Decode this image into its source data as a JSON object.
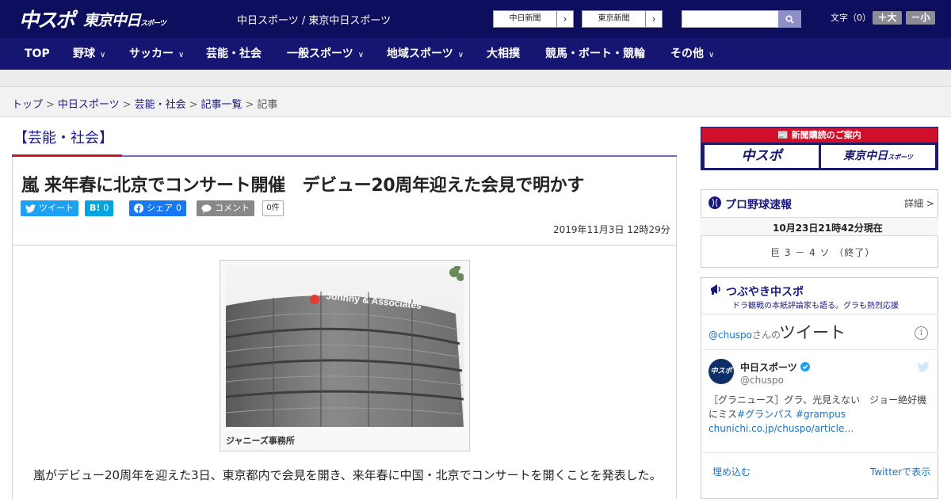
{
  "header": {
    "logo_chuspo": "中スポ",
    "logo_tokyo": "東京中日",
    "logo_tokyo_small": "スポーツ",
    "site_links": "中日スポーツ / 東京中日スポーツ",
    "paper_chunichi": "中日新聞",
    "paper_tokyo": "東京新聞",
    "search_placeholder": "",
    "font_size_label": "文字（0）",
    "font_larger": "＋大",
    "font_smaller": "－小"
  },
  "nav": {
    "items": [
      "TOP",
      "野球",
      "サッカー",
      "芸能・社会",
      "一般スポーツ",
      "地域スポーツ",
      "大相撲",
      "競馬・ボート・競輪",
      "その他"
    ]
  },
  "breadcrumb": {
    "top": "トップ",
    "chunichi_sports": "中日スポーツ",
    "section": "芸能・社会",
    "list": "記事一覧",
    "current": "記事",
    "sep": ">"
  },
  "article": {
    "section_label": "【芸能・社会】",
    "headline": "嵐 来年春に北京でコンサート開催　デビュー20周年迎えた会見で明かす",
    "share_tweet": "ツイート",
    "share_hatena": "B!",
    "share_hatena_count": "0",
    "share_facebook": "シェア",
    "share_facebook_count": "0",
    "share_comment": "コメント",
    "comment_count": "0件",
    "date": "2019年11月3日 12時29分",
    "photo_sign": "Johnny & Associates",
    "photo_caption": "ジャニーズ事務所",
    "body": "嵐がデビュー20周年を迎えた3日、東京都内で会見を開き、来年春に中国・北京でコンサートを開くことを発表した。"
  },
  "sidebar": {
    "subscription": {
      "title": "新聞購読のご案内",
      "chuspo": "中スポ",
      "tokyo": "東京中日",
      "tokyo_small": "スポーツ"
    },
    "baseball": {
      "title": "プロ野球速報",
      "detail": "詳細 >",
      "time": "10月23日21時42分現在",
      "score": "巨 3 － 4 ソ （終了）"
    },
    "tweets": {
      "title": "つぶやき中スポ",
      "subtitle": "ドラ観戦の本紙評論家も語る。グラも熱烈応援",
      "handle_prefix": "@chuspo",
      "handle_suffix": "さんの",
      "big_label": "ツイート",
      "avatar_text": "中スポ",
      "name": "中日スポーツ",
      "at": "@chuspo",
      "body_plain": "［グラニュース］グラ、光見えない　ジョー絶好機にミス",
      "body_tag1": "#グランパス",
      "body_tag2": "#grampus",
      "body_link": "chunichi.co.jp/chuspo/article…",
      "embed": "埋め込む",
      "view_on_twitter": "Twitterで表示"
    }
  },
  "colors": {
    "header_bg": "#0e0e5e",
    "nav_bg": "#161672",
    "accent_red": "#d0102b",
    "link_blue": "#1a1a7e",
    "twitter_blue": "#1da1f2",
    "facebook_blue": "#1877f2",
    "hatena_blue": "#00a4de"
  }
}
